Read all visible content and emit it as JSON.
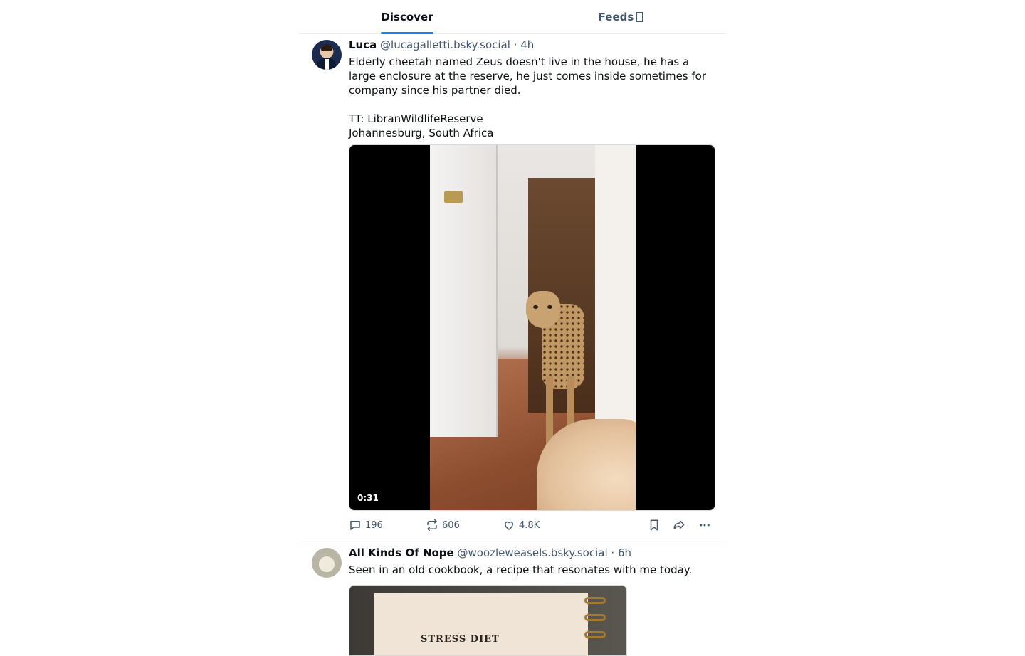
{
  "tabs": {
    "discover": "Discover",
    "feeds": "Feeds"
  },
  "posts": [
    {
      "name": "Luca",
      "handle": "@lucagalletti.bsky.social",
      "separator": "·",
      "time": "4h",
      "text": "Elderly cheetah named Zeus doesn't live in the house, he has a large enclosure at the reserve, he just comes inside sometimes for company since his partner died.\n\nTT: LibranWildlifeReserve\nJohannesburg, South Africa",
      "video_duration": "0:31",
      "replies": "196",
      "reposts": "606",
      "likes": "4.8K"
    },
    {
      "name": "All Kinds Of Nope",
      "handle": "@woozleweasels.bsky.social",
      "separator": "·",
      "time": "6h",
      "text": "Seen in an old cookbook, a recipe that resonates with me today.",
      "image_title": "STRESS DIET"
    }
  ],
  "colors": {
    "accent": "#1083fe",
    "muted": "#42576c",
    "border": "#e6e9ed"
  }
}
